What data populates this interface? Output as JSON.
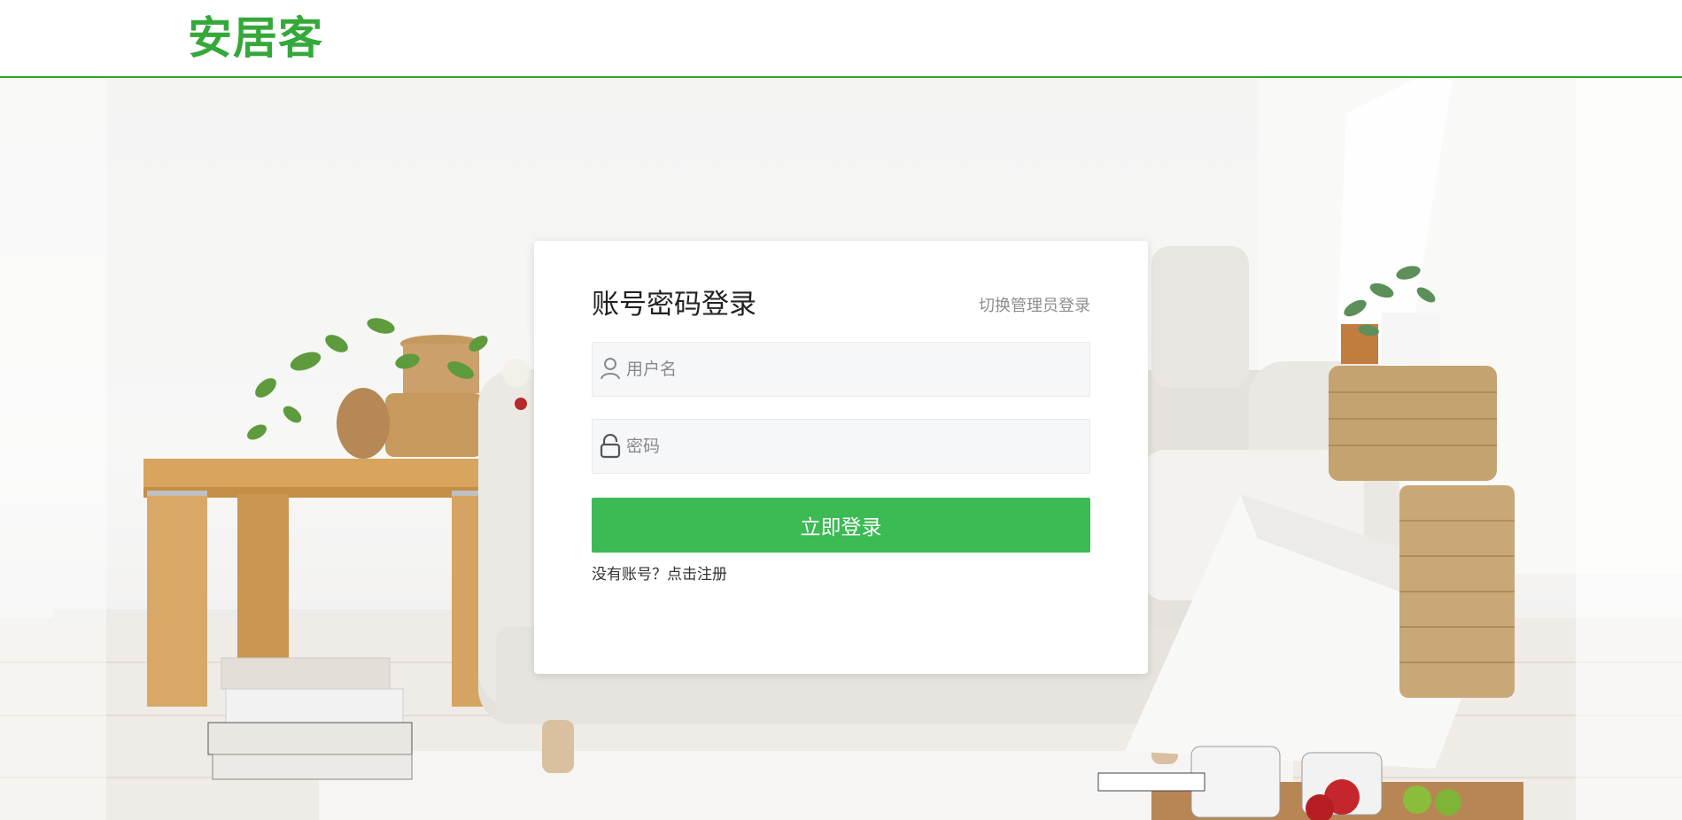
{
  "header": {
    "logo_text": "安居客"
  },
  "login": {
    "title": "账号密码登录",
    "switch_label": "切换管理员登录",
    "username_placeholder": "用户名",
    "password_placeholder": "密码",
    "submit_label": "立即登录",
    "register_prompt": "没有账号？",
    "register_link": "点击注册"
  },
  "icons": {
    "username": "user-icon",
    "password": "lock-icon"
  },
  "colors": {
    "brand_green": "#35a83a",
    "button_green": "#3cba54",
    "header_border": "#2fa62a"
  }
}
